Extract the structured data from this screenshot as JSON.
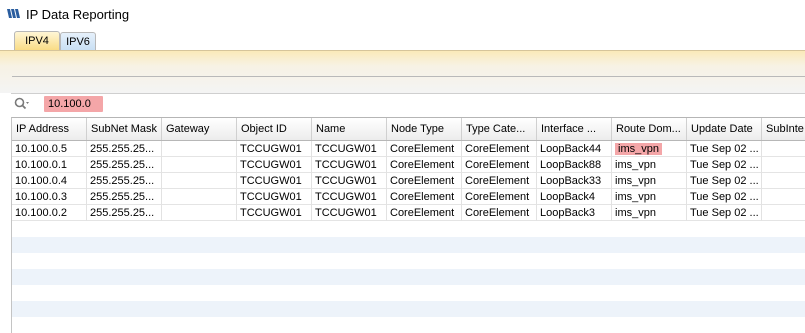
{
  "window": {
    "title": "IP Data Reporting"
  },
  "tabs": [
    {
      "label": "IPV4",
      "active": true
    },
    {
      "label": "IPV6",
      "active": false
    }
  ],
  "search": {
    "value": "10.100.0",
    "icon": "search-icon"
  },
  "table": {
    "columns": [
      "IP Address",
      "SubNet Mask",
      "Gateway",
      "Object ID",
      "Name",
      "Node Type",
      "Type Cate...",
      "Interface ...",
      "Route Dom...",
      "Update Date",
      "SubInte"
    ],
    "rows": [
      [
        "10.100.0.5",
        "255.255.25...",
        "",
        "TCCUGW01",
        "TCCUGW01",
        "CoreElement",
        "CoreElement",
        "LoopBack44",
        "ims_vpn",
        "Tue Sep 02 ...",
        ""
      ],
      [
        "10.100.0.1",
        "255.255.25...",
        "",
        "TCCUGW01",
        "TCCUGW01",
        "CoreElement",
        "CoreElement",
        "LoopBack88",
        "ims_vpn",
        "Tue Sep 02 ...",
        ""
      ],
      [
        "10.100.0.4",
        "255.255.25...",
        "",
        "TCCUGW01",
        "TCCUGW01",
        "CoreElement",
        "CoreElement",
        "LoopBack33",
        "ims_vpn",
        "Tue Sep 02 ...",
        ""
      ],
      [
        "10.100.0.3",
        "255.255.25...",
        "",
        "TCCUGW01",
        "TCCUGW01",
        "CoreElement",
        "CoreElement",
        "LoopBack4",
        "ims_vpn",
        "Tue Sep 02 ...",
        ""
      ],
      [
        "10.100.0.2",
        "255.255.25...",
        "",
        "TCCUGW01",
        "TCCUGW01",
        "CoreElement",
        "CoreElement",
        "LoopBack3",
        "ims_vpn",
        "Tue Sep 02 ...",
        ""
      ]
    ]
  },
  "colors": {
    "highlight": "#f4a6a8",
    "tab_active": "#f9dc86",
    "tab_inactive": "#c9e0f4",
    "stripe": "#edf3fa"
  }
}
